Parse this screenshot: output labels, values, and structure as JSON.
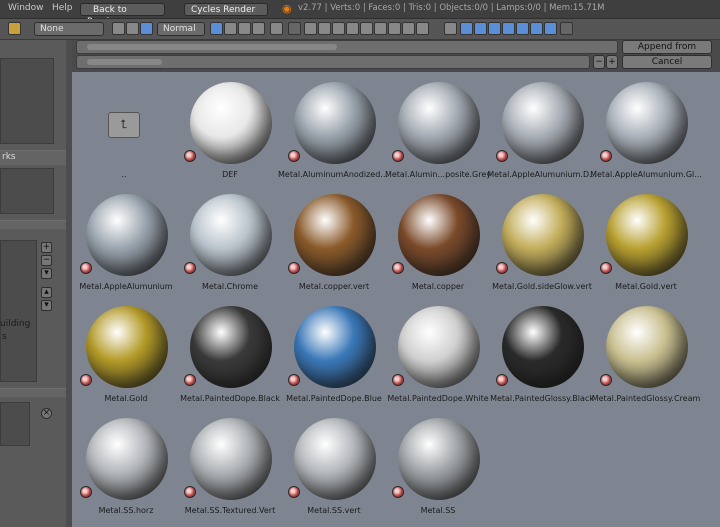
{
  "menubar": {
    "window": "Window",
    "help": "Help",
    "back_to_previous": "Back to Previous",
    "render_engine": "Cycles Render",
    "stats": "v2.77 | Verts:0 | Faces:0 | Tris:0 | Objects:0/0 | Lamps:0/0 | Mem:15.71M"
  },
  "toolbar": {
    "display_mode": "None",
    "sort_mode": "Normal"
  },
  "file_browser": {
    "append_button": "Append from Library",
    "cancel_button": "Cancel",
    "parent_dir_label": ".."
  },
  "left_panel": {
    "partial_label_1": "rks",
    "partial_label_2": "uilding",
    "partial_label_3": "s"
  },
  "materials": [
    {
      "label": "DEF",
      "color": "#e8e8e8"
    },
    {
      "label": "Metal.AluminumAnodized....",
      "color": "#9aa3ad"
    },
    {
      "label": "Metal.Alumin...posite.Grey",
      "color": "#a3aab2"
    },
    {
      "label": "Metal.AppleAlumunium.D...",
      "color": "#a8aeb6"
    },
    {
      "label": "Metal.AppleAlumunium.Gl...",
      "color": "#aab1ba"
    },
    {
      "label": "Metal.AppleAlumunium",
      "color": "#9aa4ae"
    },
    {
      "label": "Metal.Chrome",
      "color": "#b9c3cc"
    },
    {
      "label": "Metal.copper.vert",
      "color": "#8a5a2a"
    },
    {
      "label": "Metal.copper",
      "color": "#7a4a2a"
    },
    {
      "label": "Metal.Gold.sideGlow.vert",
      "color": "#c2ad5a"
    },
    {
      "label": "Metal.Gold.vert",
      "color": "#b8a030"
    },
    {
      "label": "Metal.Gold",
      "color": "#b39a28"
    },
    {
      "label": "Metal.PaintedDope.Black",
      "color": "#3a3a3a"
    },
    {
      "label": "Metal.PaintedDope.Blue",
      "color": "#3a78b8"
    },
    {
      "label": "Metal.PaintedDope.White",
      "color": "#d0d0d0"
    },
    {
      "label": "Metal.PaintedGlossy.Black",
      "color": "#2a2a2a"
    },
    {
      "label": "Metal.PaintedGlossy.Cream",
      "color": "#c9c090"
    },
    {
      "label": "Metal.SS.horz",
      "color": "#b3b7bb"
    },
    {
      "label": "Metal.SS.Textured.Vert",
      "color": "#aeb2b6"
    },
    {
      "label": "Metal.SS.vert",
      "color": "#b4b8bc"
    },
    {
      "label": "Metal.SS",
      "color": "#a0a4a8"
    }
  ]
}
